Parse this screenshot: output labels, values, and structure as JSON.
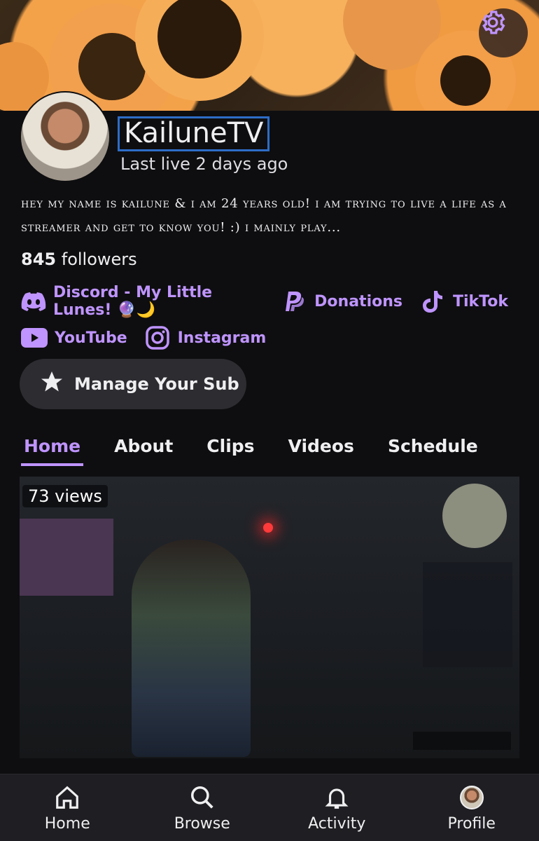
{
  "channel": {
    "name": "KailuneTV",
    "last_live": "Last live 2 days ago",
    "bio": "hey my name is kailune & i am 24 years old! i am trying to live a life as a streamer and get to know you! :) i mainly play...",
    "followers_count": "845",
    "followers_label": "followers"
  },
  "links": [
    {
      "label": "Discord - My Little Lunes! 🔮🌙",
      "icon": "discord-icon"
    },
    {
      "label": "Donations",
      "icon": "paypal-icon"
    },
    {
      "label": "TikTok",
      "icon": "tiktok-icon"
    },
    {
      "label": "YouTube",
      "icon": "youtube-icon"
    },
    {
      "label": "Instagram",
      "icon": "instagram-icon"
    }
  ],
  "sub_button": {
    "label": "Manage Your Sub"
  },
  "tabs": [
    {
      "label": "Home",
      "active": true
    },
    {
      "label": "About"
    },
    {
      "label": "Clips"
    },
    {
      "label": "Videos"
    },
    {
      "label": "Schedule"
    }
  ],
  "video": {
    "views": "73 views"
  },
  "bottom_nav": [
    {
      "label": "Home",
      "icon": "home-icon"
    },
    {
      "label": "Browse",
      "icon": "search-icon"
    },
    {
      "label": "Activity",
      "icon": "bell-icon"
    },
    {
      "label": "Profile",
      "icon": "avatar"
    }
  ],
  "colors": {
    "accent": "#bf94ff",
    "background": "#0e0e10",
    "nav_bg": "#1f1f23",
    "button_bg": "#2c2c31"
  }
}
